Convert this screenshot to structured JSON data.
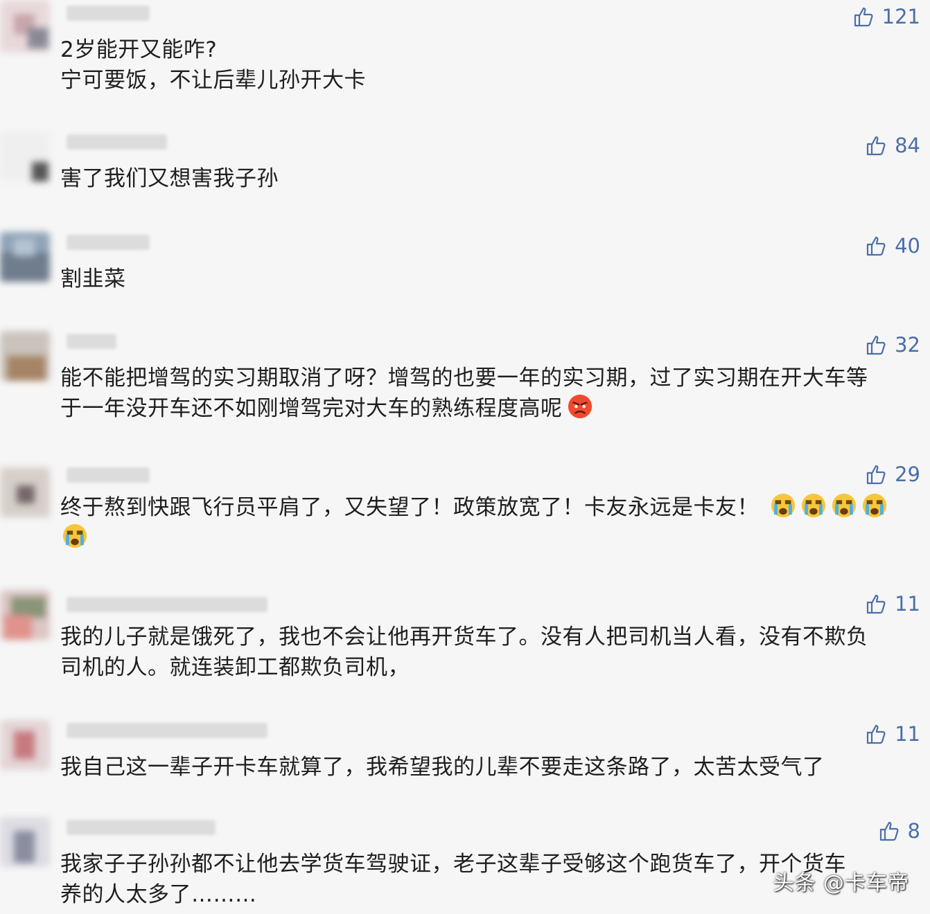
{
  "comments": [
    {
      "likes": "121",
      "lines": [
        "2岁能开又能咋?",
        "宁可要饭，不让后辈儿孙开大卡"
      ]
    },
    {
      "likes": "84",
      "lines": [
        "害了我们又想害我子孙"
      ]
    },
    {
      "likes": "40",
      "lines": [
        "割韭菜"
      ]
    },
    {
      "likes": "32",
      "lines": [
        "能不能把增驾的实习期取消了呀？增驾的也要一年的实习期，过了实习期在开大车等",
        "于一年没开车还不如刚增驾完对大车的熟练程度高呢"
      ],
      "emoji": "angry-face"
    },
    {
      "likes": "29",
      "lines": [
        "终于熬到快跟飞行员平肩了，又失望了！政策放宽了！卡友永远是卡友！",
        ""
      ],
      "emoji": "crying-face"
    },
    {
      "likes": "11",
      "lines": [
        "我的儿子就是饿死了，我也不会让他再开货车了。没有人把司机当人看，没有不欺负",
        "司机的人。就连装卸工都欺负司机，"
      ]
    },
    {
      "likes": "11",
      "lines": [
        "我自己这一辈子开卡车就算了，我希望我的儿辈不要走这条路了，太苦太受气了"
      ]
    },
    {
      "likes": "8",
      "lines": [
        "我家子子孙孙都不让他去学货车驾驶证，老子这辈子受够这个跑货车了，开个货车",
        "养的人太多了………"
      ]
    }
  ],
  "watermark": "头条 @卡车帝",
  "colors": {
    "background": "#f6f6f6",
    "text": "#1e1e1e",
    "like_blue": "#4a6ea9"
  }
}
